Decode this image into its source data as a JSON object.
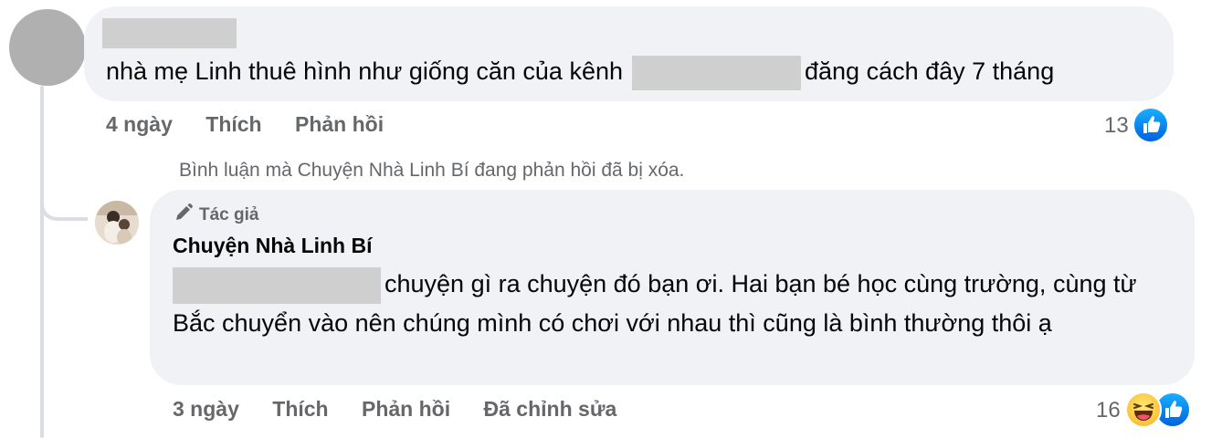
{
  "comment": {
    "text_before": "nhà mẹ Linh thuê hình như giống căn của kênh",
    "text_after": "đăng cách đây 7 tháng",
    "time": "4 ngày",
    "like_label": "Thích",
    "reply_label": "Phản hồi",
    "reaction_count": "13",
    "reaction_icons": [
      "like-icon"
    ]
  },
  "deleted_notice": "Bình luận mà Chuyện Nhà Linh Bí đang phản hồi đã bị xóa.",
  "reply": {
    "author_badge": "Tác giả",
    "author_name": "Chuyện Nhà Linh Bí",
    "text": "chuyện gì ra chuyện đó bạn ơi. Hai bạn bé học cùng trường, cùng từ Bắc chuyển vào nên chúng mình có chơi với nhau thì cũng là bình thường thôi ạ",
    "time": "3 ngày",
    "like_label": "Thích",
    "reply_label": "Phản hồi",
    "edited_label": "Đã chỉnh sửa",
    "reaction_count": "16",
    "reaction_icons": [
      "haha-icon",
      "like-icon"
    ]
  },
  "colors": {
    "bubble_bg": "#f0f2f5",
    "meta_text": "#65676b",
    "like_blue": "#0866ff",
    "redaction": "#cfcfcf"
  }
}
